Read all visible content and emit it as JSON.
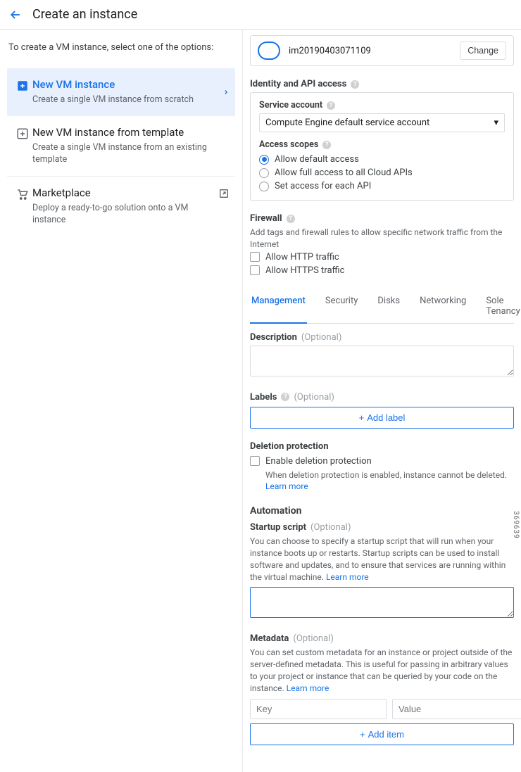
{
  "header": {
    "title": "Create an instance"
  },
  "sidebar": {
    "intro": "To create a VM instance, select one of the options:",
    "options": [
      {
        "title": "New VM instance",
        "desc": "Create a single VM instance from scratch"
      },
      {
        "title": "New VM instance from template",
        "desc": "Create a single VM instance from an existing template"
      },
      {
        "title": "Marketplace",
        "desc": "Deploy a ready-to-go solution onto a VM instance"
      }
    ]
  },
  "form": {
    "boot": {
      "name": "im20190403071109",
      "change": "Change"
    },
    "identity": {
      "heading": "Identity and API access",
      "service_label": "Service account",
      "service_value": "Compute Engine default service account",
      "scopes_label": "Access scopes",
      "scopes": [
        "Allow default access",
        "Allow full access to all Cloud APIs",
        "Set access for each API"
      ]
    },
    "firewall": {
      "heading": "Firewall",
      "hint": "Add tags and firewall rules to allow specific network traffic from the Internet",
      "http": "Allow HTTP traffic",
      "https": "Allow HTTPS traffic"
    },
    "tabs": [
      "Management",
      "Security",
      "Disks",
      "Networking",
      "Sole Tenancy"
    ],
    "description": {
      "label": "Description",
      "optional": "(Optional)"
    },
    "labels": {
      "label": "Labels",
      "optional": "(Optional)",
      "add": "Add label"
    },
    "deletion": {
      "heading": "Deletion protection",
      "checkbox": "Enable deletion protection",
      "hint": "When deletion protection is enabled, instance cannot be deleted.",
      "learn": "Learn more"
    },
    "automation": {
      "heading": "Automation",
      "startup_label": "Startup script",
      "optional": "(Optional)",
      "startup_hint": "You can choose to specify a startup script that will run when your instance boots up or restarts. Startup scripts can be used to install software and updates, and to ensure that services are running within the virtual machine.",
      "learn": "Learn more"
    },
    "metadata": {
      "label": "Metadata",
      "optional": "(Optional)",
      "hint": "You can set custom metadata for an instance or project outside of the server-defined metadata. This is useful for passing in arbitrary values to your project or instance that can be queried by your code on the instance.",
      "learn": "Learn more",
      "key_ph": "Key",
      "value_ph": "Value",
      "add": "Add item"
    }
  },
  "image_number": "369639"
}
